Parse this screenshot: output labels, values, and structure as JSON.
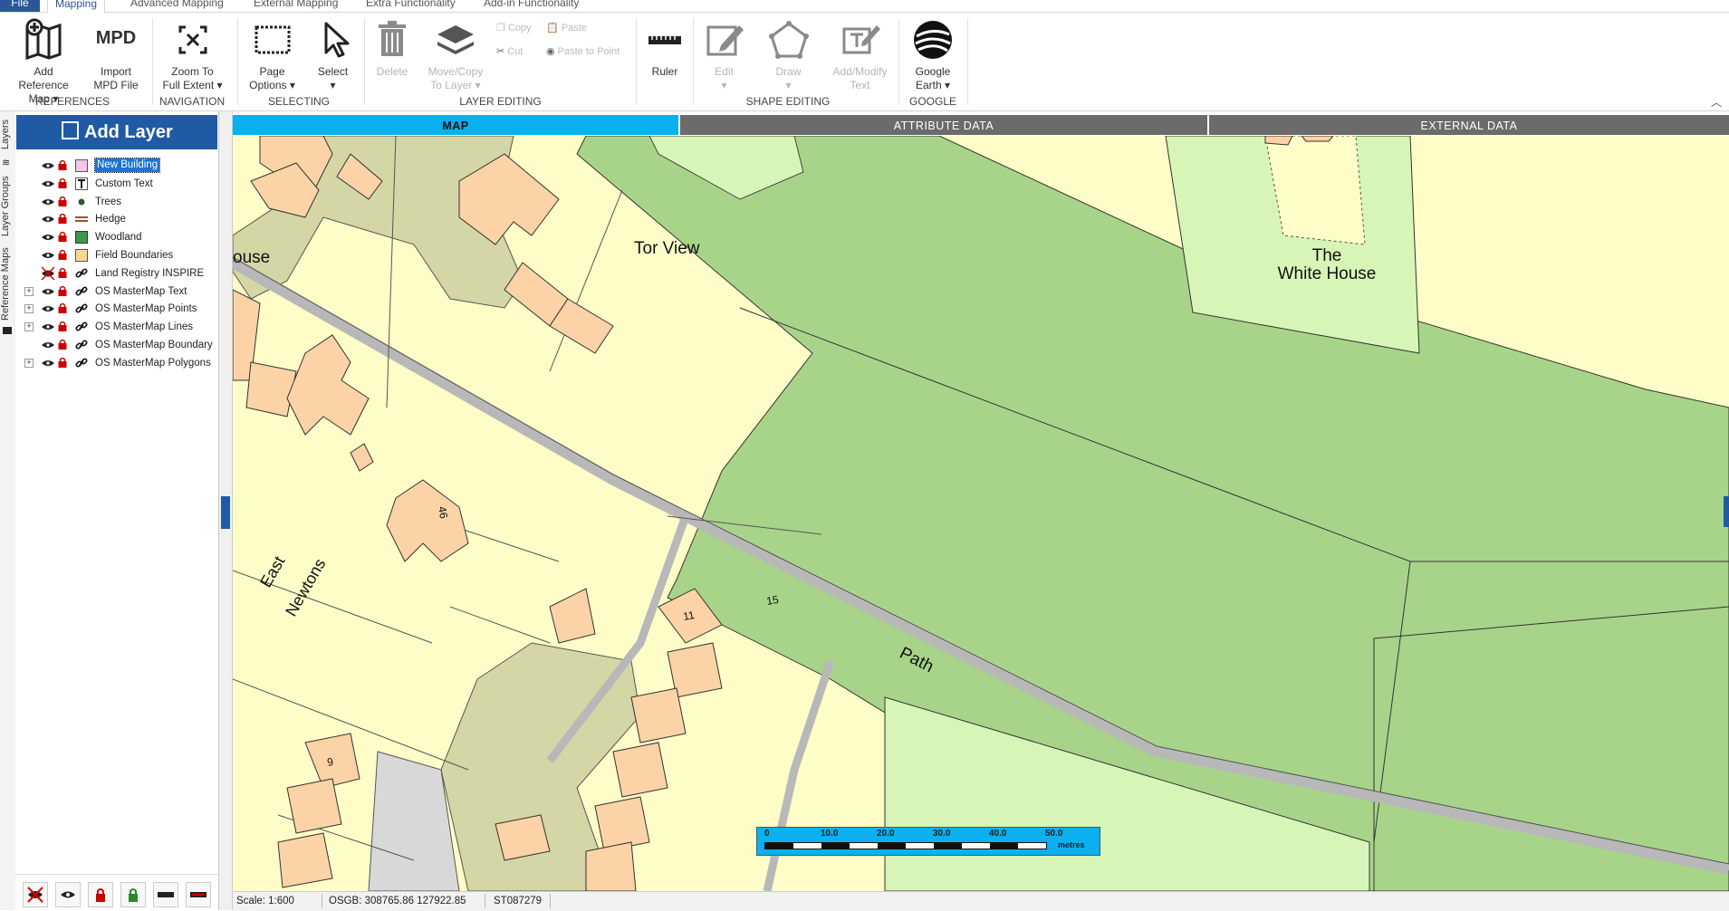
{
  "ribbon_tabs": [
    "File",
    "Mapping",
    "Advanced Mapping",
    "External Mapping",
    "Extra Functionality",
    "Add-in Functionality"
  ],
  "buttons": {
    "add_reference_map": [
      "Add Reference",
      "Map ▾"
    ],
    "import_mpd": [
      "Import",
      "MPD File"
    ],
    "mpd_icon": "MPD",
    "zoom_full": [
      "Zoom To",
      "Full Extent ▾"
    ],
    "page_options": [
      "Page",
      "Options ▾"
    ],
    "select": [
      "Select",
      "▾"
    ],
    "delete": "Delete",
    "move_copy": [
      "Move/Copy",
      "To Layer ▾"
    ],
    "copy": "Copy",
    "paste": "Paste",
    "cut": "Cut",
    "paste_to_point": "Paste to Point",
    "ruler": "Ruler",
    "edit": [
      "Edit",
      "▾"
    ],
    "draw": [
      "Draw",
      "▾"
    ],
    "add_modify_text": [
      "Add/Modify",
      "Text"
    ],
    "google_earth": [
      "Google",
      "Earth ▾"
    ]
  },
  "groups": [
    "REFERENCES",
    "NAVIGATION",
    "SELECTING",
    "LAYER EDITING",
    "SHAPE EDITING",
    "GOOGLE"
  ],
  "side_tabs": [
    "Layers",
    "Layer Groups",
    "Reference Maps"
  ],
  "panel_title": "Add Layer",
  "layers": [
    {
      "name": "New Building",
      "expandable": false,
      "symbol": "pink-fill"
    },
    {
      "name": "Custom Text",
      "expandable": false,
      "symbol": "text"
    },
    {
      "name": "Trees",
      "expandable": false,
      "symbol": "tree"
    },
    {
      "name": "Hedge",
      "expandable": false,
      "symbol": "hedge"
    },
    {
      "name": "Woodland",
      "expandable": false,
      "symbol": "woodland"
    },
    {
      "name": "Field Boundaries",
      "expandable": false,
      "symbol": "field"
    },
    {
      "name": "Land Registry INSPIRE",
      "expandable": false,
      "symbol": "link"
    },
    {
      "name": "OS MasterMap Text",
      "expandable": true,
      "symbol": "link"
    },
    {
      "name": "OS MasterMap Points",
      "expandable": true,
      "symbol": "link"
    },
    {
      "name": "OS MasterMap Lines",
      "expandable": true,
      "symbol": "link"
    },
    {
      "name": "OS MasterMap Boundary",
      "expandable": false,
      "symbol": "link"
    },
    {
      "name": "OS MasterMap Polygons",
      "expandable": true,
      "symbol": "link"
    }
  ],
  "view_tabs": [
    "MAP",
    "ATTRIBUTE DATA",
    "EXTERNAL DATA"
  ],
  "map_labels": {
    "tor_view": "Tor View",
    "white_house_1": "The",
    "white_house_2": "White House",
    "ouse": "ouse",
    "east": "East",
    "newtons": "Newtons",
    "path": "Path",
    "n46": "46",
    "n11": "11",
    "n15": "15",
    "n9": "9"
  },
  "scale_bar": {
    "ticks": [
      "0",
      "10.0",
      "20.0",
      "30.0",
      "40.0",
      "50.0"
    ],
    "unit": "metres"
  },
  "status": {
    "scale": "Scale: 1:600",
    "coords": "OSGB: 308765.86  127922.85",
    "grid_ref": "ST087279"
  },
  "colors": {
    "accent": "#1f5aa5",
    "map_tab": "#0ab0ef",
    "woodland": "#a8d48a",
    "building": "#fbd3a6",
    "land": "#fefdc8",
    "road": "#b8b8b8"
  }
}
